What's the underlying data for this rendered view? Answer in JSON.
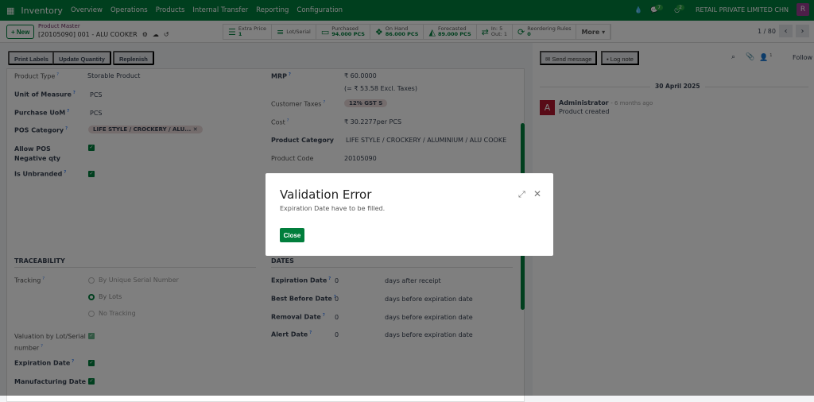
{
  "nav": {
    "app": "Inventory",
    "menu": [
      "Overview",
      "Operations",
      "Products",
      "Internal Transfer",
      "Reporting",
      "Configuration"
    ],
    "messages_count": "7",
    "activities_count": "2",
    "company": "RETAIL PRIVATE LIMITED CHN",
    "avatar": "R"
  },
  "control": {
    "new": "+ New",
    "breadcrumb": "Product Master",
    "record": "[20105090] 001 - ALU COOKER",
    "stats": [
      {
        "label": "Extra Price",
        "value": "1",
        "icon": "list"
      },
      {
        "label": "Lot/Serial",
        "value": "",
        "icon": "bars"
      },
      {
        "label": "Purchased",
        "value": "94.000 PCS",
        "icon": "credit-card"
      },
      {
        "label": "On Hand",
        "value": "86.000 PCS",
        "icon": "cubes"
      },
      {
        "label": "Forecasted",
        "value": "89.000 PCS",
        "icon": "area-chart"
      },
      {
        "label": "In: 5",
        "value": "Out: 1",
        "icon": "exchange"
      },
      {
        "label": "Reordering Rules",
        "value": "0",
        "icon": "refresh"
      }
    ],
    "more": "More ▾",
    "pager": "1 / 80"
  },
  "actions": [
    "Print Labels",
    "Update Quantity",
    "Replenish"
  ],
  "form": {
    "left": [
      {
        "label": "Product Type",
        "value": "Storable Product"
      },
      {
        "label": "Unit of Measure",
        "value": "PCS"
      },
      {
        "label": "Purchase UoM",
        "value": "PCS"
      },
      {
        "label": "POS Category",
        "value": "LIFE STYLE / CROCKERY / ALU..."
      },
      {
        "label": "Allow POS Negative qty"
      },
      {
        "label": "Is Unbranded"
      }
    ],
    "right": [
      {
        "label": "MRP",
        "value": "₹ 60.0000",
        "sub": "(= ₹ 53.58 Excl. Taxes)"
      },
      {
        "label": "Customer Taxes",
        "value": "12% GST S"
      },
      {
        "label": "Cost",
        "value": "₹ 30.2277per PCS"
      },
      {
        "label": "Product Category",
        "value": "LIFE STYLE / CROCKERY / ALUMINIUM / ALU COOKE"
      },
      {
        "label": "Product Code",
        "value": "20105090"
      }
    ],
    "traceability": {
      "title": "TRACEABILITY",
      "tracking_label": "Tracking",
      "options": [
        "By Unique Serial Number",
        "By Lots",
        "No Tracking"
      ],
      "selected": "By Lots",
      "valuation": "Valuation by Lot/Serial number",
      "expiration": "Expiration Date",
      "manufacturing": "Manufacturing Date"
    },
    "dates": {
      "title": "DATES",
      "rows": [
        {
          "label": "Expiration Date",
          "value": "0",
          "unit": "days after receipt"
        },
        {
          "label": "Best Before Date",
          "value": "0",
          "unit": "days before expiration date"
        },
        {
          "label": "Removal Date",
          "value": "0",
          "unit": "days before expiration date"
        },
        {
          "label": "Alert Date",
          "value": "0",
          "unit": "days before expiration date"
        }
      ]
    }
  },
  "chatter": {
    "send": "Send message",
    "log": "Log note",
    "followers": "1",
    "follow": "Follow",
    "date": "30 April 2025",
    "author": "Administrator",
    "time": "- 6 months ago",
    "body": "Product created",
    "avatar": "A"
  },
  "modal": {
    "title": "Validation Error",
    "message": "Expiration Date have to be filled.",
    "close": "Close"
  },
  "colors": {
    "brand": "#017e3c",
    "avatar": "#9b3f92",
    "admin_avatar": "#b0162e"
  }
}
